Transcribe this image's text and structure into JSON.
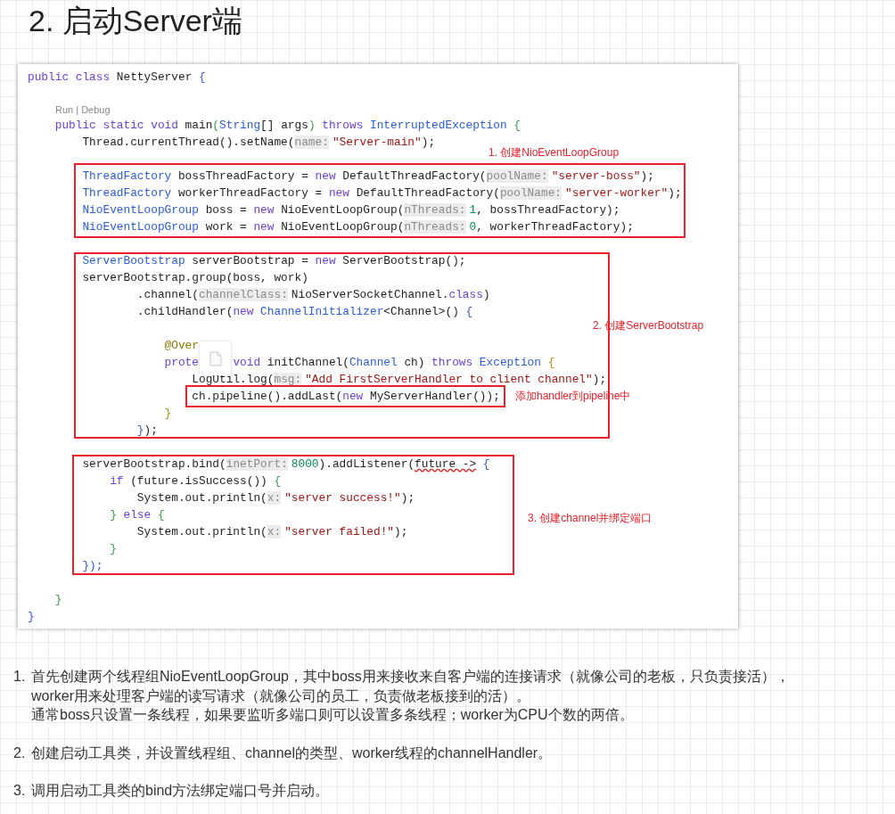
{
  "heading": "2. 启动Server端",
  "code": {
    "lines": [
      {
        "kind": "code",
        "tokens": [
          {
            "text": "public class",
            "kind": "kw"
          },
          {
            "text": " NettyServer ",
            "kind": "plain"
          },
          {
            "text": "{",
            "kind": "b1"
          }
        ]
      },
      {
        "kind": "blank"
      },
      {
        "kind": "codelens",
        "text": "Run | Debug"
      },
      {
        "kind": "code",
        "tokens": [
          {
            "text": "    public static void",
            "kind": "kw"
          },
          {
            "text": " main",
            "kind": "plain"
          },
          {
            "text": "(",
            "kind": "b2"
          },
          {
            "text": "String",
            "kind": "type"
          },
          {
            "text": "[] args",
            "kind": "plain"
          },
          {
            "text": ")",
            "kind": "b2"
          },
          {
            "text": " throws",
            "kind": "kw"
          },
          {
            "text": " InterruptedException ",
            "kind": "type"
          },
          {
            "text": "{",
            "kind": "b2"
          }
        ]
      },
      {
        "kind": "code",
        "tokens": [
          {
            "text": "        Thread.currentThread().setName(",
            "kind": "plain"
          },
          {
            "text": "name:",
            "kind": "hint"
          },
          {
            "text": "\"Server-main\"",
            "kind": "str"
          },
          {
            "text": ");",
            "kind": "plain"
          }
        ]
      },
      {
        "kind": "blank"
      },
      {
        "kind": "code",
        "tokens": [
          {
            "text": "        ThreadFactory",
            "kind": "type"
          },
          {
            "text": " bossThreadFactory = ",
            "kind": "plain"
          },
          {
            "text": "new",
            "kind": "kw"
          },
          {
            "text": " DefaultThreadFactory(",
            "kind": "plain"
          },
          {
            "text": "poolName:",
            "kind": "hint"
          },
          {
            "text": "\"server-boss\"",
            "kind": "str"
          },
          {
            "text": ");",
            "kind": "plain"
          }
        ]
      },
      {
        "kind": "code",
        "tokens": [
          {
            "text": "        ThreadFactory",
            "kind": "type"
          },
          {
            "text": " workerThreadFactory = ",
            "kind": "plain"
          },
          {
            "text": "new",
            "kind": "kw"
          },
          {
            "text": " DefaultThreadFactory(",
            "kind": "plain"
          },
          {
            "text": "poolName:",
            "kind": "hint"
          },
          {
            "text": "\"server-worker\"",
            "kind": "str"
          },
          {
            "text": ");",
            "kind": "plain"
          }
        ]
      },
      {
        "kind": "code",
        "tokens": [
          {
            "text": "        NioEventLoopGroup",
            "kind": "type"
          },
          {
            "text": " boss = ",
            "kind": "plain"
          },
          {
            "text": "new",
            "kind": "kw"
          },
          {
            "text": " NioEventLoopGroup(",
            "kind": "plain"
          },
          {
            "text": "nThreads:",
            "kind": "hint"
          },
          {
            "text": "1",
            "kind": "num"
          },
          {
            "text": ", bossThreadFactory);",
            "kind": "plain"
          }
        ]
      },
      {
        "kind": "code",
        "tokens": [
          {
            "text": "        NioEventLoopGroup",
            "kind": "type"
          },
          {
            "text": " work = ",
            "kind": "plain"
          },
          {
            "text": "new",
            "kind": "kw"
          },
          {
            "text": " NioEventLoopGroup(",
            "kind": "plain"
          },
          {
            "text": "nThreads:",
            "kind": "hint"
          },
          {
            "text": "0",
            "kind": "num"
          },
          {
            "text": ", workerThreadFactory);",
            "kind": "plain"
          }
        ]
      },
      {
        "kind": "blank"
      },
      {
        "kind": "code",
        "tokens": [
          {
            "text": "        ServerBootstrap",
            "kind": "type"
          },
          {
            "text": " serverBootstrap = ",
            "kind": "plain"
          },
          {
            "text": "new",
            "kind": "kw"
          },
          {
            "text": " ServerBootstrap();",
            "kind": "plain"
          }
        ]
      },
      {
        "kind": "code",
        "tokens": [
          {
            "text": "        serverBootstrap.group(boss, work)",
            "kind": "plain"
          }
        ]
      },
      {
        "kind": "code",
        "tokens": [
          {
            "text": "                .channel(",
            "kind": "plain"
          },
          {
            "text": "channelClass:",
            "kind": "hint"
          },
          {
            "text": "NioServerSocketChannel.",
            "kind": "plain"
          },
          {
            "text": "class",
            "kind": "kw"
          },
          {
            "text": ")",
            "kind": "plain"
          }
        ]
      },
      {
        "kind": "code",
        "tokens": [
          {
            "text": "                .childHandler(",
            "kind": "plain"
          },
          {
            "text": "new",
            "kind": "kw"
          },
          {
            "text": " ChannelInitializer",
            "kind": "type"
          },
          {
            "text": "<Channel>() ",
            "kind": "plain"
          },
          {
            "text": "{",
            "kind": "b1"
          }
        ]
      },
      {
        "kind": "blank"
      },
      {
        "kind": "code",
        "tokens": [
          {
            "text": "                    @Over",
            "kind": "anno"
          }
        ]
      },
      {
        "kind": "interrupted",
        "segments": [
          {
            "tokens": [
              {
                "text": "                    prote",
                "kind": "kw"
              }
            ]
          },
          {
            "tokens": [
              {
                "text": "void",
                "kind": "kw"
              },
              {
                "text": " initChannel(",
                "kind": "plain"
              },
              {
                "text": "Channel",
                "kind": "type"
              },
              {
                "text": " ch) ",
                "kind": "plain"
              },
              {
                "text": "throws",
                "kind": "kw"
              },
              {
                "text": " Exception ",
                "kind": "type"
              },
              {
                "text": "{",
                "kind": "b3"
              }
            ]
          }
        ]
      },
      {
        "kind": "code",
        "tokens": [
          {
            "text": "                        LogUtil.log(",
            "kind": "plain"
          },
          {
            "text": "msg:",
            "kind": "hint"
          },
          {
            "text": "\"Add FirstServerHandler to client channel\"",
            "kind": "str"
          },
          {
            "text": ");",
            "kind": "plain"
          }
        ]
      },
      {
        "kind": "framed",
        "tokens": [
          {
            "text": "                        ch.pipeline().addLast(",
            "kind": "plain"
          },
          {
            "text": "new",
            "kind": "kw"
          },
          {
            "text": " MyServerHandler());",
            "kind": "plain"
          }
        ]
      },
      {
        "kind": "code",
        "tokens": [
          {
            "text": "                    }",
            "kind": "b3"
          }
        ]
      },
      {
        "kind": "code",
        "tokens": [
          {
            "text": "                }",
            "kind": "b1"
          },
          {
            "text": ");",
            "kind": "plain"
          }
        ]
      },
      {
        "kind": "blank"
      },
      {
        "kind": "code",
        "tokens": [
          {
            "text": "        serverBootstrap.bind(",
            "kind": "plain"
          },
          {
            "text": "inetPort:",
            "kind": "hint"
          },
          {
            "text": "8000",
            "kind": "num"
          },
          {
            "text": ").addListener(",
            "kind": "plain"
          },
          {
            "text": "future ->",
            "kind": "squiggle"
          },
          {
            "text": " {",
            "kind": "b1"
          }
        ]
      },
      {
        "kind": "code",
        "tokens": [
          {
            "text": "            if",
            "kind": "kw"
          },
          {
            "text": " (future.isSuccess()) ",
            "kind": "plain"
          },
          {
            "text": "{",
            "kind": "b2"
          }
        ]
      },
      {
        "kind": "code",
        "tokens": [
          {
            "text": "                System.out.println(",
            "kind": "plain"
          },
          {
            "text": "x:",
            "kind": "hint"
          },
          {
            "text": "\"server success!\"",
            "kind": "str"
          },
          {
            "text": ");",
            "kind": "plain"
          }
        ]
      },
      {
        "kind": "code",
        "tokens": [
          {
            "text": "            }",
            "kind": "b2"
          },
          {
            "text": " else",
            "kind": "kw"
          },
          {
            "text": " {",
            "kind": "b2"
          }
        ]
      },
      {
        "kind": "code",
        "tokens": [
          {
            "text": "                System.out.println(",
            "kind": "plain"
          },
          {
            "text": "x:",
            "kind": "hint"
          },
          {
            "text": "\"server failed!\"",
            "kind": "str"
          },
          {
            "text": ");",
            "kind": "plain"
          }
        ]
      },
      {
        "kind": "code",
        "tokens": [
          {
            "text": "            }",
            "kind": "b2"
          }
        ]
      },
      {
        "kind": "code",
        "tokens": [
          {
            "text": "        });",
            "kind": "b1"
          }
        ]
      },
      {
        "kind": "blank"
      },
      {
        "kind": "code",
        "tokens": [
          {
            "text": "    }",
            "kind": "b2"
          }
        ]
      },
      {
        "kind": "code",
        "tokens": [
          {
            "text": "}",
            "kind": "b1"
          }
        ]
      }
    ],
    "annotations": [
      {
        "kind": "group",
        "label": "1. 创建NioEventLoopGroup"
      },
      {
        "kind": "bootstrap",
        "label": "2. 创建ServerBootstrap"
      },
      {
        "kind": "handler",
        "label": "添加handler到pipeline中"
      },
      {
        "kind": "bind",
        "label": "3. 创建channel并绑定端口"
      }
    ]
  },
  "notes": [
    {
      "number": "1.",
      "lines": [
        "首先创建两个线程组NioEventLoopGroup，其中boss用来接收来自客户端的连接请求（就像公司的老板，只负责接活），",
        "worker用来处理客户端的读写请求（就像公司的员工，负责做老板接到的活）。",
        "通常boss只设置一条线程，如果要监听多端口则可以设置多条线程；worker为CPU个数的两倍。"
      ]
    },
    {
      "number": "2.",
      "lines": [
        "创建启动工具类，并设置线程组、channel的类型、worker线程的channelHandler。"
      ]
    },
    {
      "number": "3.",
      "lines": [
        "调用启动工具类的bind方法绑定端口号并启动。"
      ]
    }
  ]
}
